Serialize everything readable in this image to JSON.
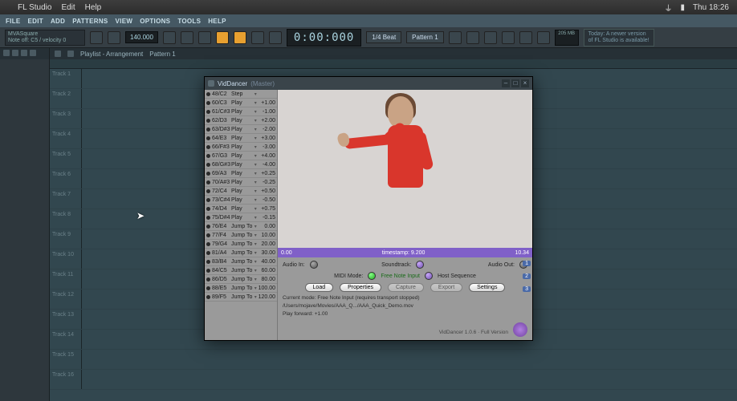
{
  "macos": {
    "app": "FL Studio",
    "edit": "Edit",
    "help": "Help",
    "time": "Thu 18:26"
  },
  "fl_menu": [
    "FILE",
    "EDIT",
    "ADD",
    "PATTERNS",
    "VIEW",
    "OPTIONS",
    "TOOLS",
    "HELP"
  ],
  "hint": {
    "line1": "MVASquare",
    "line2": "Note off: C5 / velocity 0"
  },
  "transport": {
    "bpm": "140.000",
    "time": "0:00:000",
    "beat_div": "1/4 Beat",
    "pattern": "Pattern 1",
    "cpu": "205 MB",
    "newer1": "Today: A newer version",
    "newer2": "of FL Studio is available!"
  },
  "playlist": {
    "title": "Playlist - Arrangement",
    "pattern": "Pattern 1"
  },
  "tracks": [
    "Track 1",
    "Track 2",
    "Track 3",
    "Track 4",
    "Track 5",
    "Track 6",
    "Track 7",
    "Track 8",
    "Track 9",
    "Track 10",
    "Track 11",
    "Track 12",
    "Track 13",
    "Track 14",
    "Track 15",
    "Track 16"
  ],
  "plugin": {
    "title": "VidDancer",
    "subtitle": "(Master)",
    "timeline": {
      "left": "0.00",
      "center": "timestamp: 9.200",
      "right": "10.34"
    },
    "audio_in": "Audio In:",
    "soundtrack": "Soundtrack:",
    "audio_out": "Audio Out:",
    "midi_mode": "MIDI Mode:",
    "free_note": "Free Note Input",
    "host_seq": "Host Sequence",
    "btn_load": "Load",
    "btn_props": "Properties",
    "btn_capture": "Capture",
    "btn_export": "Export",
    "btn_settings": "Settings",
    "side1": "1",
    "side2": "2",
    "side3": "3",
    "status1": "Current mode: Free Note Input (requires transport stopped)",
    "status2": "/Users/mojave/Movies/AAA_Q.../AAA_Quick_Demo.mov",
    "status3": "Play forward: +1.00",
    "version": "VidDancer 1.0.6 · Full Version"
  },
  "midi_rows": [
    {
      "n": "48/C2",
      "a": "Step",
      "v": ""
    },
    {
      "n": "60/C3",
      "a": "Play",
      "v": "+1.00"
    },
    {
      "n": "61/C#3",
      "a": "Play",
      "v": "-1.00"
    },
    {
      "n": "62/D3",
      "a": "Play",
      "v": "+2.00"
    },
    {
      "n": "63/D#3",
      "a": "Play",
      "v": "-2.00"
    },
    {
      "n": "64/E3",
      "a": "Play",
      "v": "+3.00"
    },
    {
      "n": "66/F#3",
      "a": "Play",
      "v": "-3.00"
    },
    {
      "n": "67/G3",
      "a": "Play",
      "v": "+4.00"
    },
    {
      "n": "68/G#3",
      "a": "Play",
      "v": "-4.00"
    },
    {
      "n": "69/A3",
      "a": "Play",
      "v": "+0.25"
    },
    {
      "n": "70/A#3",
      "a": "Play",
      "v": "-0.25"
    },
    {
      "n": "72/C4",
      "a": "Play",
      "v": "+0.50"
    },
    {
      "n": "73/C#4",
      "a": "Play",
      "v": "-0.50"
    },
    {
      "n": "74/D4",
      "a": "Play",
      "v": "+0.75"
    },
    {
      "n": "75/D#4",
      "a": "Play",
      "v": "-0.15"
    },
    {
      "n": "76/E4",
      "a": "Jump To",
      "v": "0.00"
    },
    {
      "n": "77/F4",
      "a": "Jump To",
      "v": "10.00"
    },
    {
      "n": "79/G4",
      "a": "Jump To",
      "v": "20.00"
    },
    {
      "n": "81/A4",
      "a": "Jump To",
      "v": "30.00"
    },
    {
      "n": "83/B4",
      "a": "Jump To",
      "v": "40.00"
    },
    {
      "n": "84/C5",
      "a": "Jump To",
      "v": "60.00"
    },
    {
      "n": "86/D5",
      "a": "Jump To",
      "v": "80.00"
    },
    {
      "n": "88/E5",
      "a": "Jump To",
      "v": "100.00"
    },
    {
      "n": "89/F5",
      "a": "Jump To",
      "v": "120.00"
    }
  ]
}
